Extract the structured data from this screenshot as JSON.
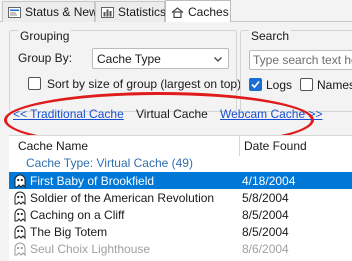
{
  "tabs": [
    {
      "label": "Status & News",
      "icon": "status-icon"
    },
    {
      "label": "Statistics",
      "icon": "bar-chart-icon"
    },
    {
      "label": "Caches",
      "icon": "home-icon"
    }
  ],
  "grouping": {
    "title": "Grouping",
    "group_by_label": "Group By:",
    "group_by_value": "Cache Type",
    "sort_label": "Sort by size of group (largest on top)",
    "sort_checked": false
  },
  "search": {
    "title": "Search",
    "placeholder": "Type search text here",
    "logs_label": "Logs",
    "logs_checked": true,
    "names_label": "Names",
    "names_checked": false
  },
  "nav": {
    "prev": "<< Traditional Cache",
    "current": "Virtual Cache",
    "next": "Webcam Cache >>"
  },
  "list": {
    "columns": [
      "Cache Name",
      "Date Found"
    ],
    "group_label": "Cache Type: Virtual Cache (49)",
    "rows": [
      {
        "name": "First Baby of Brookfield",
        "date": "4/18/2004",
        "selected": true
      },
      {
        "name": "Soldier of the American Revolution",
        "date": "5/8/2004",
        "selected": false
      },
      {
        "name": "Caching on a Cliff",
        "date": "8/5/2004",
        "selected": false
      },
      {
        "name": "The Big Totem",
        "date": "8/5/2004",
        "selected": false
      },
      {
        "name": "Seul Choix Lighthouse",
        "date": "8/6/2004",
        "selected": false
      }
    ]
  },
  "colors": {
    "accent": "#0078d7",
    "link": "#1a4fd4",
    "highlight_oval": "#e01b1b",
    "group_text": "#2f6fb0"
  }
}
